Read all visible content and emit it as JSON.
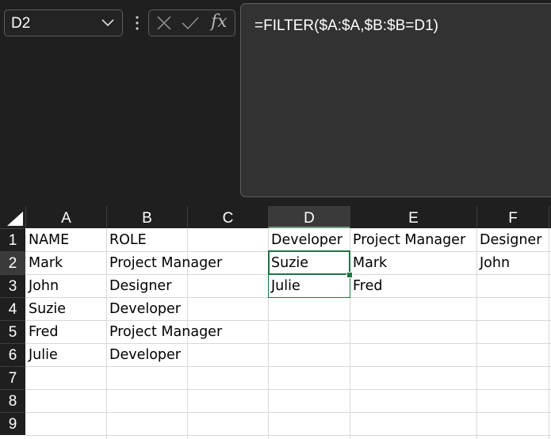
{
  "formula_bar": {
    "name_box": "D2",
    "fx_label": "fx",
    "formula": "=FILTER($A:$A,$B:$B=D1)"
  },
  "columns": [
    "A",
    "B",
    "C",
    "D",
    "E",
    "F"
  ],
  "active_column": "D",
  "rows": [
    "1",
    "2",
    "3",
    "4",
    "5",
    "6",
    "7",
    "8",
    "9"
  ],
  "active_row": "2",
  "cells": {
    "A1": "NAME",
    "B1": "ROLE",
    "D1": "Developer",
    "E1": "Project Manager",
    "F1": "Designer",
    "A2": "Mark",
    "B2": "Project Manager",
    "D2": "Suzie",
    "E2": "Mark",
    "F2": "John",
    "A3": "John",
    "B3": "Designer",
    "D3": "Julie",
    "E3": "Fred",
    "A4": "Suzie",
    "B4": "Developer",
    "A5": "Fred",
    "B5": "Project Manager",
    "A6": "Julie",
    "B6": "Developer"
  },
  "colors": {
    "selection": "#217346",
    "header_bg": "#1f1f1f",
    "active_header_bg": "#3a3a3a"
  }
}
